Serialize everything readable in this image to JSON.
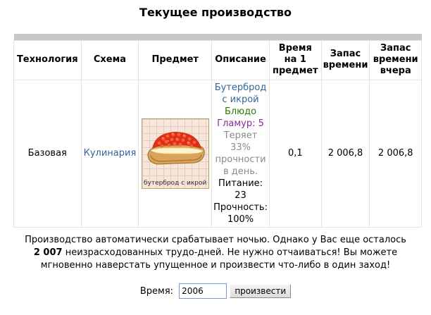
{
  "page": {
    "title": "Текущее производство"
  },
  "table": {
    "headers": {
      "technology": "Технология",
      "scheme": "Схема",
      "item": "Предмет",
      "description": "Описание",
      "time_per_item": "Время на 1 предмет",
      "time_reserve": "Запас времени",
      "time_reserve_yesterday": "Запас времени вчера"
    },
    "row": {
      "technology": "Базовая",
      "scheme": "Кулинария",
      "item_caption": "бутерброд с икрой",
      "item_icon": "caviar-sandwich-image",
      "description": {
        "name": "Бутерброд с икрой",
        "type": "Блюдо",
        "glamour": "Гламур: 5",
        "decay": "Теряет 33% прочности в день.",
        "nutrition": "Питание: 23",
        "durability": "Прочность: 100%"
      },
      "time_per_item": "0,1",
      "time_reserve": "2 006,8",
      "time_reserve_yesterday": "2 006,8"
    }
  },
  "notice": {
    "text_before": "Производство автоматически срабатывает ночью. Однако у Вас еще осталось",
    "days_count": "2 007",
    "text_after": "неизрасходованных трудо-дней. Не нужно отчаиваться! Вы можете мгновенно наверстать упущенное и произвести что-либо в один заход!"
  },
  "form": {
    "time_label": "Время:",
    "time_value": "2006",
    "submit_label": "произвести"
  },
  "colors": {
    "link": "#336699",
    "type_green": "#2a7a00",
    "glamour_purple": "#8a2a9a",
    "muted_gray": "#8a8a8a",
    "header_bar": "#c8c8c8"
  }
}
